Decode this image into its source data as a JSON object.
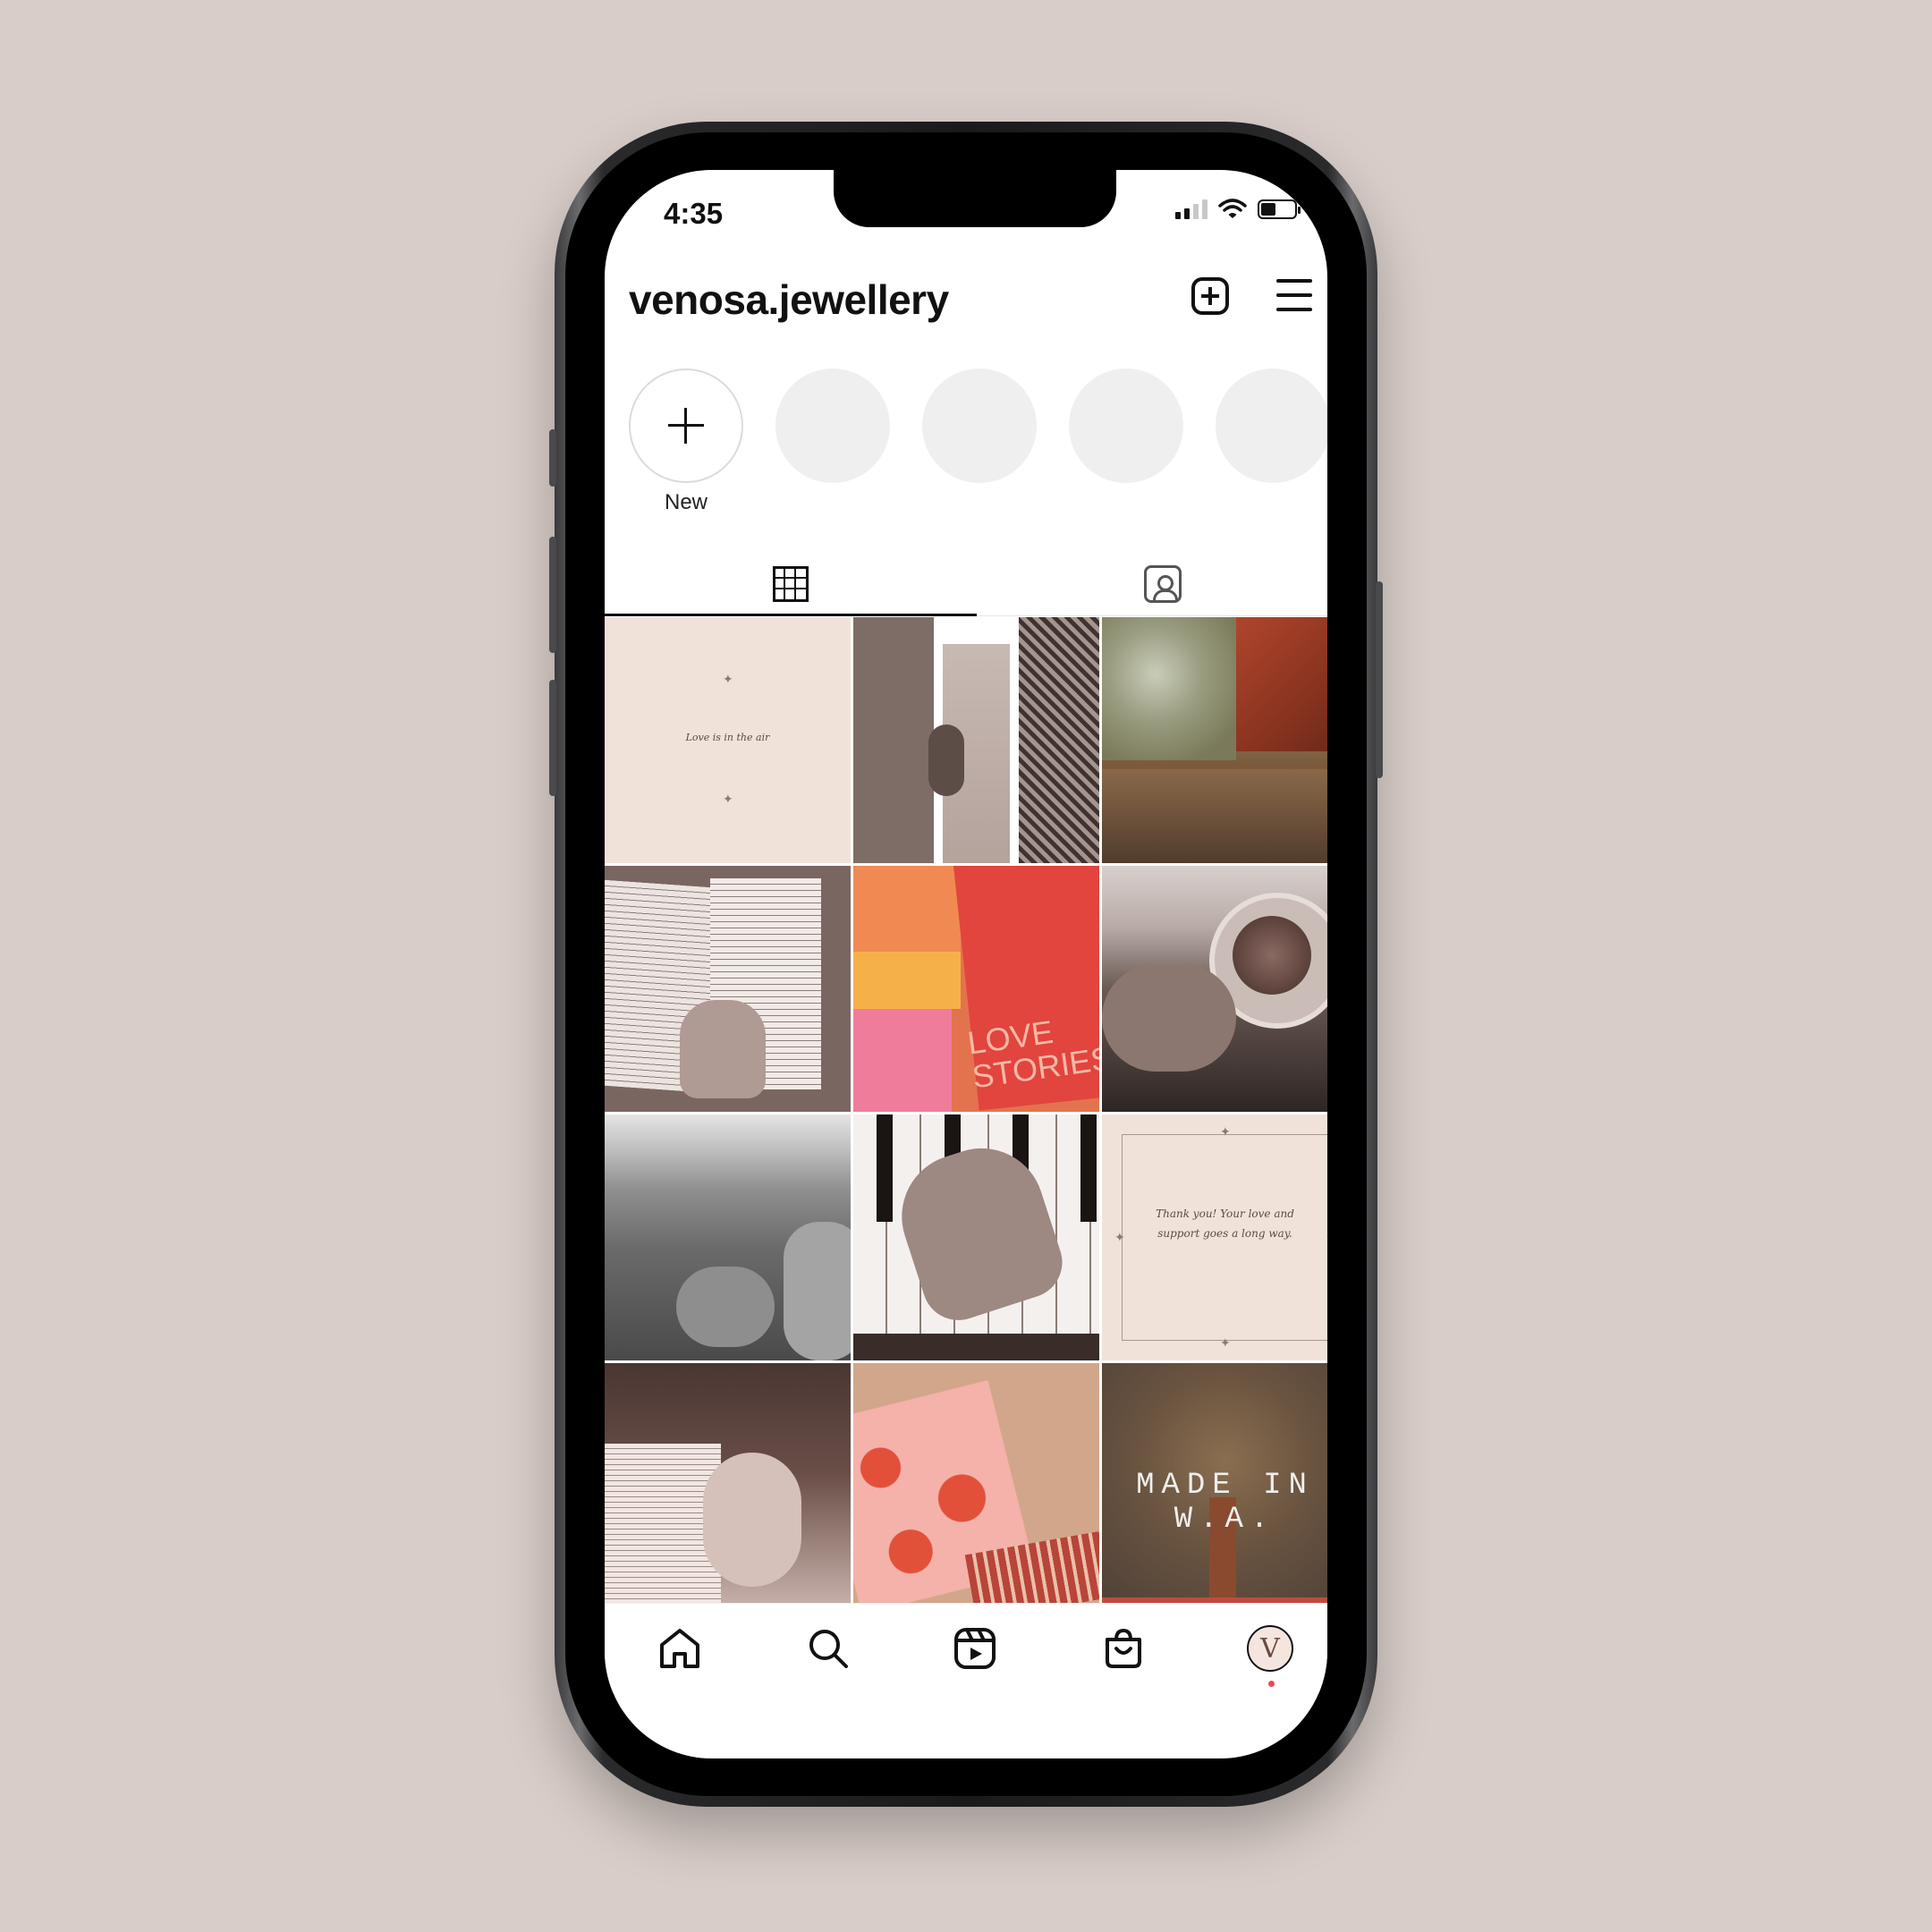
{
  "status_bar": {
    "time": "4:35"
  },
  "header": {
    "username": "venosa.jewellery"
  },
  "highlights": {
    "new_label": "New",
    "placeholder_count": 4
  },
  "posts": [
    {
      "caption": "Love is in the air"
    },
    {
      "caption": ""
    },
    {
      "caption": ""
    },
    {
      "caption": ""
    },
    {
      "caption": "LOVE STORIES"
    },
    {
      "caption": ""
    },
    {
      "caption": ""
    },
    {
      "caption": ""
    },
    {
      "caption": "Thank you! Your love and support goes a long way."
    },
    {
      "caption": ""
    },
    {
      "caption": ""
    },
    {
      "caption": "MADE IN W.A."
    }
  ],
  "colors": {
    "page_background": "#d8cdc8",
    "accent_notification": "#ed4956",
    "brand_blush": "#f1e2d9"
  },
  "icons": [
    "plus-square-icon",
    "hamburger-menu-icon",
    "grid-icon",
    "tagged-icon",
    "home-icon",
    "search-icon",
    "reels-icon",
    "shop-icon"
  ]
}
